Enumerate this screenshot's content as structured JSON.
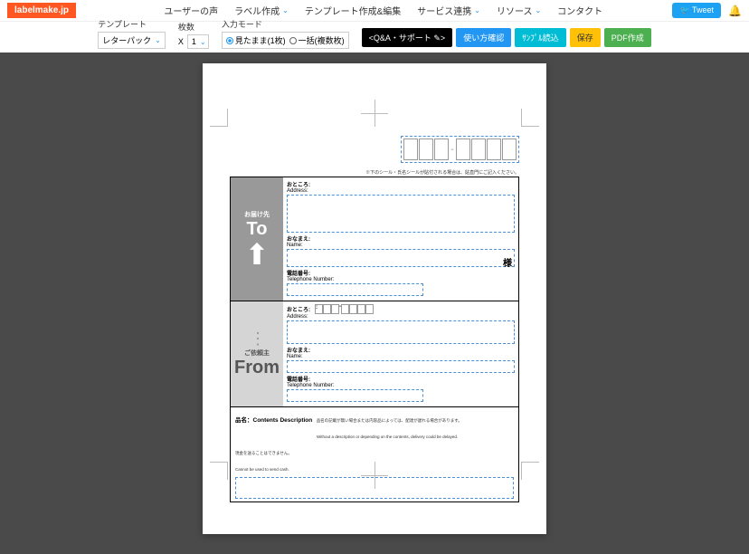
{
  "header": {
    "logo": "labelmake.jp",
    "nav": {
      "users_voice": "ユーザーの声",
      "label_create": "ラベル作成",
      "template_edit": "テンプレート作成&編集",
      "service_link": "サービス連携",
      "resource": "リソース",
      "contact": "コンタクト"
    },
    "tweet": "Tweet"
  },
  "toolbar": {
    "template_label": "テンプレート",
    "template_value": "レターパック",
    "sheets_label": "枚数",
    "x": "X",
    "sheets_value": "1",
    "input_mode_label": "入力モード",
    "mode_asis": "見たまま(1枚)",
    "mode_batch": "一括(複数枚)",
    "qa": "<Q&A・サポート ✎>",
    "usage": "使い方確認",
    "sample": "ｻﾝﾌﾟﾙ読込",
    "save": "保存",
    "pdf": "PDF作成"
  },
  "form": {
    "top_note": "※下のシール・氏名シールが貼付される場合は、貼直門にご記入ください。",
    "to": {
      "jp": "お届け先",
      "en": "To"
    },
    "from": {
      "jp": "ご依頼主",
      "en": "From"
    },
    "address_jp": "おところ",
    "address_en": "Address",
    "name_jp": "おなまえ",
    "name_en": "Name",
    "phone_jp": "電話番号",
    "phone_en": "Telephone Number",
    "sama": "様",
    "contents_jp": "品名",
    "contents_en": "Contents Description",
    "contents_note1": "品名の記載が無い場合または内容品によっては、配達が遅れる場合があります。",
    "contents_note2": "Without a description or depending on the contents, delivery could be delayed.",
    "contents_note3": "現金を送ることはできません。",
    "contents_note4": "Cannot be used to send cash."
  }
}
